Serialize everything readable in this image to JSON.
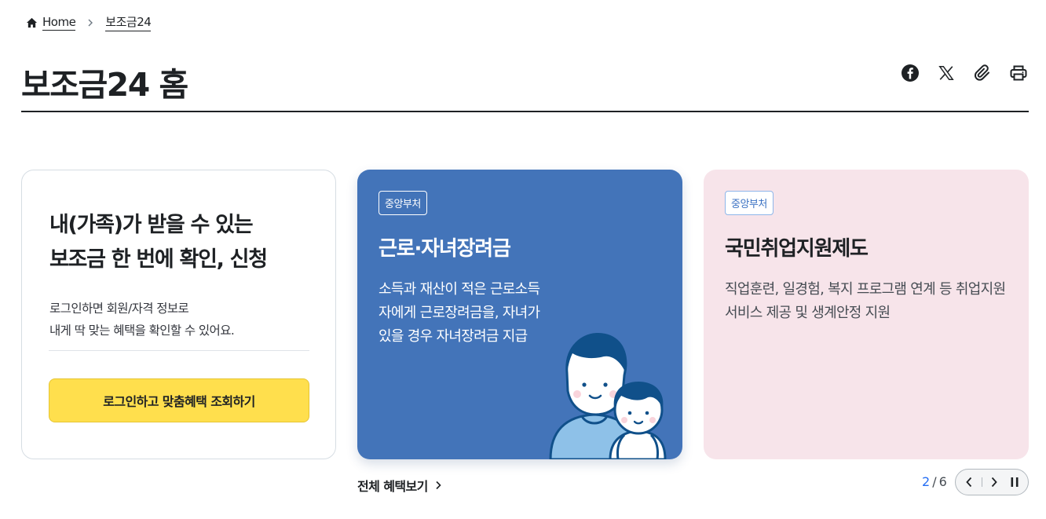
{
  "breadcrumb": {
    "home_label": "Home",
    "current_label": "보조금24"
  },
  "page": {
    "title": "보조금24 홈"
  },
  "share": {
    "icons": [
      "facebook-icon",
      "x-icon",
      "link-icon",
      "print-icon"
    ]
  },
  "login_card": {
    "headline_line1": "내(가족)가 받을 수 있는",
    "headline_line2": "보조금 한 번에 확인, 신청",
    "desc_line1": "로그인하면 회원/자격 정보로",
    "desc_line2": "내게 딱 맞는 혜택을 확인할 수 있어요.",
    "cta_label": "로그인하고 맞춤혜택 조회하기",
    "cta_color": "#ffdf4d"
  },
  "slides": [
    {
      "badge": "중앙부처",
      "title": "근로·자녀장려금",
      "desc": "소득과 재산이 적은 근로소득자에게 근로장려금을, 자녀가 있을 경우 자녀장려금 지급",
      "bg_color": "#4374b9"
    },
    {
      "badge": "중앙부처",
      "title": "국민취업지원제도",
      "desc": "직업훈련, 일경험, 복지 프로그램 연계 등 취업지원서비스 제공 및 생계안정 지원",
      "bg_color": "#f7e4ea"
    }
  ],
  "view_all_label": "전체 혜택보기",
  "pager": {
    "current": "2",
    "separator": "/",
    "total": "6"
  },
  "accent_color": "#256ef4"
}
